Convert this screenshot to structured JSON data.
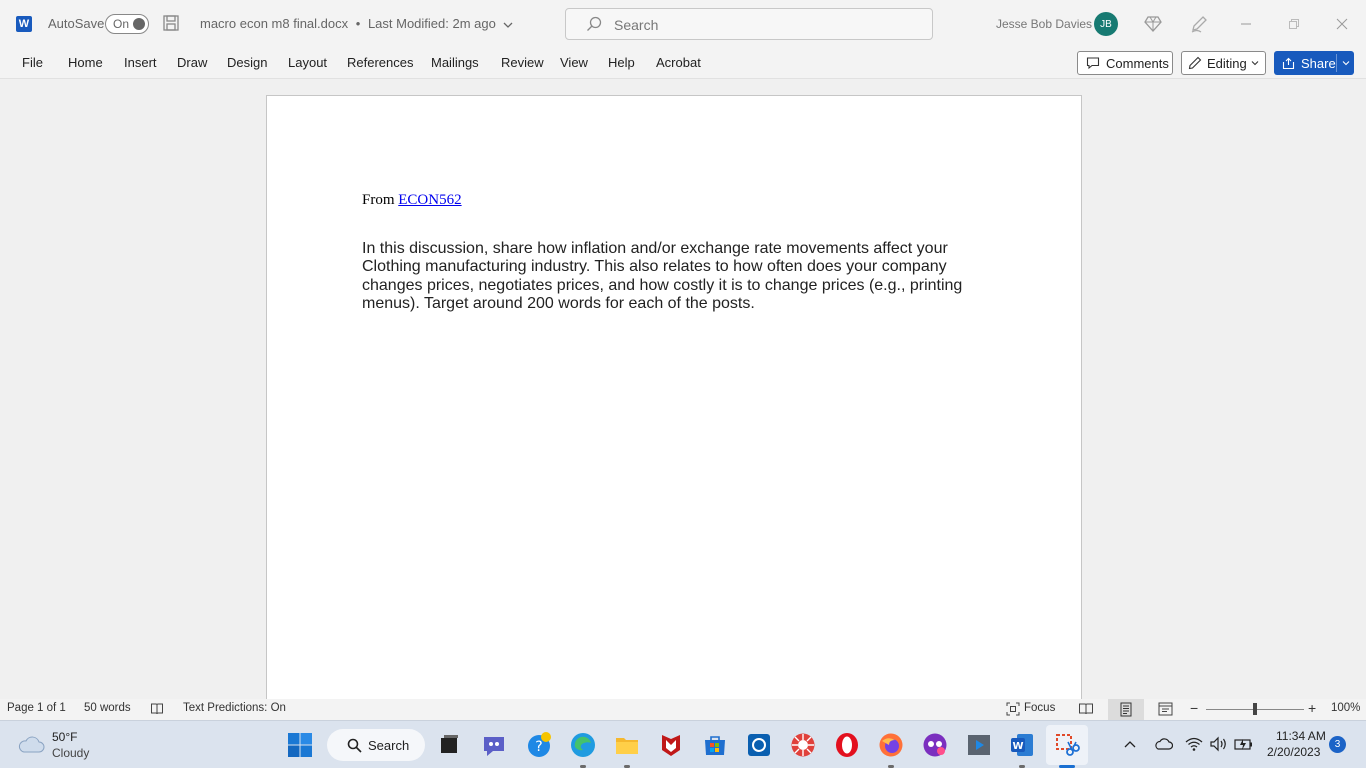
{
  "titlebar": {
    "app_logo": "W",
    "autosave_label": "AutoSave",
    "autosave_state": "On",
    "doc_name": "macro econ m8 final.docx",
    "separator": "•",
    "last_modified": "Last Modified: 2m ago",
    "search_placeholder": "Search",
    "user_name": "Jesse Bob Davies",
    "user_initials": "JB"
  },
  "ribbon": {
    "tabs": [
      "File",
      "Home",
      "Insert",
      "Draw",
      "Design",
      "Layout",
      "References",
      "Mailings",
      "Review",
      "View",
      "Help",
      "Acrobat"
    ],
    "comments_label": "Comments",
    "editing_label": "Editing",
    "share_label": "Share"
  },
  "document": {
    "from_prefix": "From ",
    "from_link": "ECON562 ",
    "body": "In this discussion, share how inflation and/or exchange rate movements affect your Clothing manufacturing industry. This also relates to how often does your company changes prices, negotiates prices, and how costly it is to change prices (e.g., printing menus). Target around 200 words for each of the posts."
  },
  "statusbar": {
    "page_info": "Page 1 of 1",
    "word_count": "50 words",
    "text_predictions": "Text Predictions: On",
    "focus_label": "Focus",
    "zoom_percent": "100%",
    "zoom_level": 1.0
  },
  "taskbar": {
    "weather_temp": "50°F",
    "weather_desc": "Cloudy",
    "search_label": "Search",
    "time": "11:34 AM",
    "date": "2/20/2023",
    "notification_count": "3"
  },
  "colors": {
    "accent": "#185abd",
    "avatar": "#177a72",
    "link": "#0000ee"
  }
}
